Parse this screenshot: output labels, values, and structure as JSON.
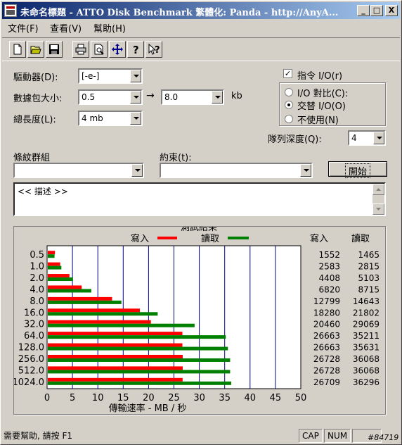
{
  "window": {
    "title": "未命名標題 - ATTO Disk Benchmark 繁體化: Panda - http://AnyA..."
  },
  "title_buttons": {
    "minimize": "_",
    "maximize": "□",
    "close": "X"
  },
  "menu": [
    {
      "label": "文件(F)"
    },
    {
      "label": "查看(V)"
    },
    {
      "label": "幫助(H)"
    }
  ],
  "toolbar": {
    "icons": [
      "new-file-icon",
      "open-folder-icon",
      "save-icon",
      "print-icon",
      "print-preview-icon",
      "move-icon",
      "help-icon",
      "context-help-icon"
    ],
    "help_glyph": "?",
    "context_help_glyph": "?"
  },
  "form": {
    "drive_label": "驅動器(D):",
    "drive_value": "[-e-]",
    "transfer_label": "數據包大小:",
    "transfer_from": "0.5",
    "arrow": "→",
    "transfer_to": "8.0",
    "transfer_unit": "kb",
    "length_label": "總長度(L):",
    "length_value": "4 mb",
    "direct_io_label": "指令 I/O(r)",
    "direct_io_checked": true,
    "check_mark": "✓",
    "io_compare_label": "I/O 對比(C):",
    "overlapped_io_label": "交替 I/O(O)",
    "neither_label": "不使用(N)",
    "selected_io_mode": "overlapped",
    "queue_depth_label": "隊列深度(Q):",
    "queue_depth_value": "4",
    "group_label": "條紋群組",
    "group_value": "",
    "constraint_label": "約束(t):",
    "constraint_value": "",
    "start_button": "開始",
    "description": "<< 描述 >>"
  },
  "chart_data": {
    "type": "bar",
    "title": "測試結果",
    "orientation": "horizontal",
    "categories": [
      "0.5",
      "1.0",
      "2.0",
      "4.0",
      "8.0",
      "16.0",
      "32.0",
      "64.0",
      "128.0",
      "256.0",
      "512.0",
      "1024.0"
    ],
    "series": [
      {
        "name": "寫入",
        "color": "#ff0000",
        "values": [
          1552,
          2583,
          4408,
          6820,
          12799,
          18280,
          20460,
          26663,
          26663,
          26728,
          26728,
          26709
        ]
      },
      {
        "name": "讀取",
        "color": "#008000",
        "values": [
          1465,
          2815,
          5103,
          8715,
          14643,
          21802,
          29069,
          35211,
          35631,
          36068,
          36068,
          36296
        ]
      }
    ],
    "xlabel": "傳輸速率 - MB / 秒",
    "xlim": [
      0,
      50
    ],
    "xticks": [
      "0",
      "5",
      "10",
      "15",
      "20",
      "25",
      "30",
      "35",
      "40",
      "45",
      "50"
    ],
    "column_headers": {
      "write": "寫入",
      "read": "讀取"
    },
    "legend_position": "top",
    "grid": true
  },
  "status": {
    "message": "需要幫助, 請按 F1",
    "cap": "CAP",
    "num": "NUM",
    "extra": "",
    "watermark": "#84719"
  }
}
